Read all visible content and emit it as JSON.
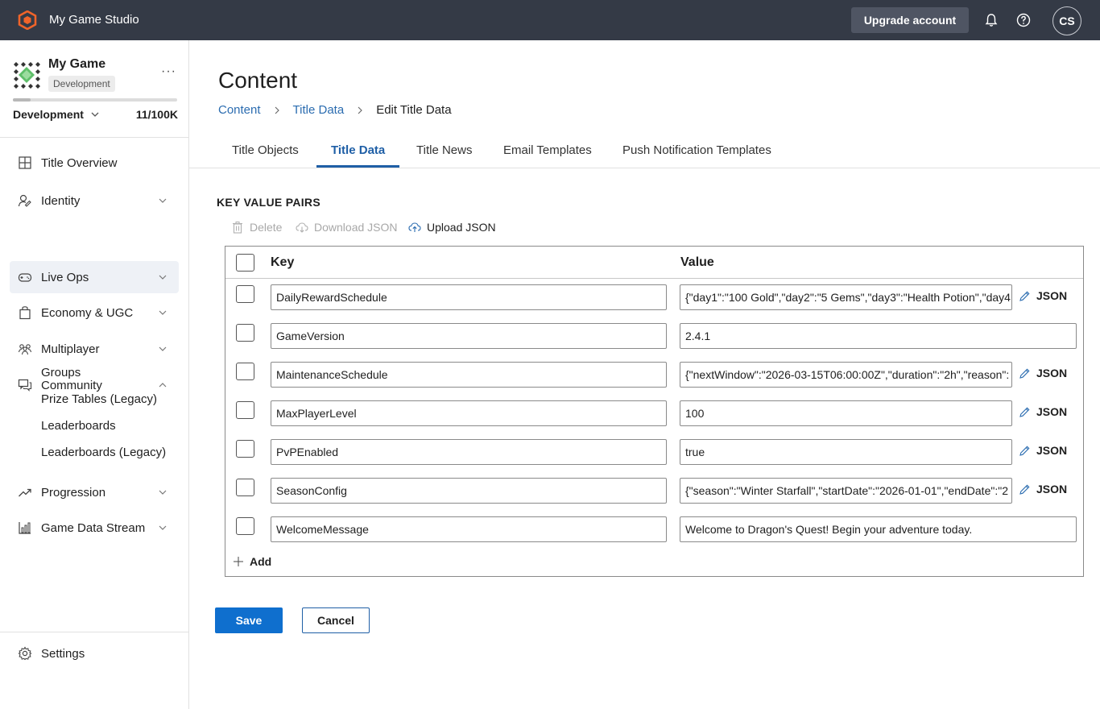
{
  "topbar": {
    "studio_name": "My Game Studio",
    "upgrade_label": "Upgrade account",
    "avatar_initials": "CS",
    "icons": [
      "studio-logo-icon",
      "bell-icon",
      "help-icon"
    ]
  },
  "sidebar": {
    "game_name": "My Game",
    "env_badge": "Development",
    "environment": "Development",
    "usage": "11/100K",
    "usage_fraction": 0.11,
    "items": [
      {
        "label": "Title Overview",
        "icon": "grid-icon"
      },
      {
        "label": "Identity",
        "icon": "identity-icon"
      },
      {
        "label": "Live Ops",
        "icon": "gamepad-icon"
      },
      {
        "label": "Economy & UGC",
        "icon": "bag-icon"
      },
      {
        "label": "Multiplayer",
        "icon": "multiplayer-icon"
      },
      {
        "label": "Community",
        "icon": "community-icon"
      },
      {
        "label": "Progression",
        "icon": "trend-icon"
      },
      {
        "label": "Game Data Stream",
        "icon": "chart-icon"
      }
    ],
    "community_sub": [
      "Groups",
      "Prize Tables (Legacy)",
      "Leaderboards",
      "Leaderboards (Legacy)"
    ],
    "settings_label": "Settings"
  },
  "main": {
    "title": "Content",
    "breadcrumb": [
      "Content",
      "Title Data",
      "Edit Title Data"
    ],
    "tabs": [
      "Title Objects",
      "Title Data",
      "Title News",
      "Email Templates",
      "Push Notification Templates"
    ],
    "active_tab": "Title Data",
    "section_label": "KEY VALUE PAIRS",
    "toolbar": {
      "delete": "Delete",
      "download": "Download JSON",
      "upload": "Upload JSON"
    },
    "table": {
      "key_header": "Key",
      "value_header": "Value",
      "rows": [
        {
          "key": "DailyRewardSchedule",
          "value": "{\"day1\":\"100 Gold\",\"day2\":\"5 Gems\",\"day3\":\"Health Potion\",\"day4",
          "json": "JSON"
        },
        {
          "key": "GameVersion",
          "value": "2.4.1",
          "json": ""
        },
        {
          "key": "MaintenanceSchedule",
          "value": "{\"nextWindow\":\"2026-03-15T06:00:00Z\",\"duration\":\"2h\",\"reason\":",
          "json": "JSON"
        },
        {
          "key": "MaxPlayerLevel",
          "value": "100",
          "json": "JSON"
        },
        {
          "key": "PvPEnabled",
          "value": "true",
          "json": "JSON"
        },
        {
          "key": "SeasonConfig",
          "value": "{\"season\":\"Winter Starfall\",\"startDate\":\"2026-01-01\",\"endDate\":\"2",
          "json": "JSON"
        },
        {
          "key": "WelcomeMessage",
          "value": "Welcome to Dragon's Quest! Begin your adventure today.",
          "json": ""
        }
      ],
      "add_label": "Add"
    },
    "save_label": "Save",
    "cancel_label": "Cancel"
  }
}
